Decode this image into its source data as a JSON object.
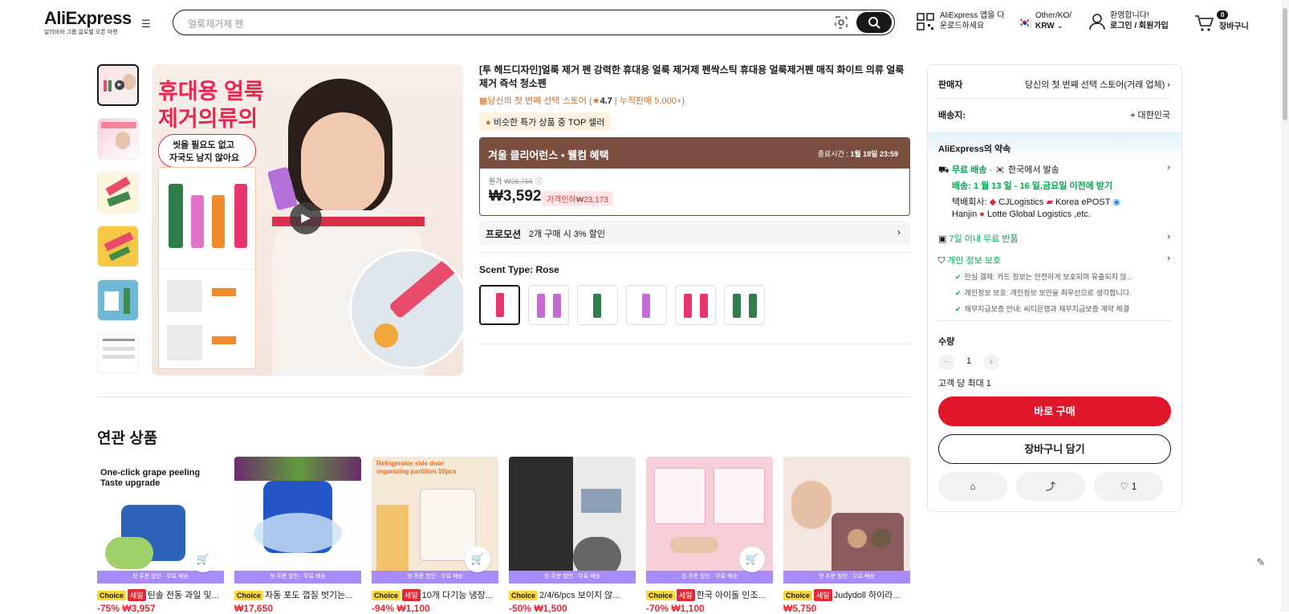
{
  "header": {
    "logo": "AliExpress",
    "logo_sub": "알리바바 그룹 글로벌 오픈 마켓",
    "search_placeholder": "얼룩제거제 펜",
    "app_line1": "AliExpress 앱을 다",
    "app_line2": "운로드하세요",
    "region_line1": "Other/KO/",
    "region_line2": "KRW",
    "account_line1": "환영합니다!",
    "account_line2": "로그인 / 회원가입",
    "cart_count": "0",
    "cart_label": "장바구니"
  },
  "product": {
    "title": "[투 헤드디자인]얼룩 제거 펜 강력한 휴대용 얼룩 제거제 펜싹스틱 휴대용 얼룩제거펜 매직 화이트 의류 얼룩제거 즉석 청소펜",
    "store_name": "당신의 첫 번째 선택 스토어",
    "rating": "4.7",
    "sold": "누적판매 5,000+",
    "top_badge": "비슷한 특가 상품 중 TOP 셀러",
    "image_text_1": "휴대용 얼룩",
    "image_text_2": "제거의류의",
    "image_text_3": "씻을 필요도 없고",
    "image_text_4": "자국도 남지 않아요"
  },
  "promo": {
    "name": "겨울 클리어런스 • 웰컴 혜택",
    "end_label": "종료시간 :",
    "end_value": "1월 18일 23:59",
    "orig_label": "원가",
    "orig_price": "₩26,765",
    "price": "₩3,592",
    "discount": "가격인하₩23,173"
  },
  "promotion_row": {
    "label": "프로모션",
    "text": "2개 구매 시 3% 할인"
  },
  "scent": {
    "label": "Scent Type: Rose"
  },
  "related": {
    "title": "연관 상품",
    "ship_text": "첫 주문 할인 · 무료 배송",
    "cards": [
      {
        "name": "틴솔 전동 과일 및...",
        "price": "-75% ₩3,957",
        "img_text": "One-click grape peeling Taste upgrade",
        "sale": true
      },
      {
        "name": "자동 포도 껍질 벗기는...",
        "price": "₩17,650",
        "img_text": "",
        "sale": false
      },
      {
        "name": "10개 다기능 냉장...",
        "price": "-94% ₩1,100",
        "img_text": "Refrigerator side door organizing partition 10pcs",
        "sale": true
      },
      {
        "name": "2/4/6/pcs 보이지 않...",
        "price": "-50% ₩1,500",
        "img_text": "",
        "sale": false
      },
      {
        "name": "한국 아이돌 인조...",
        "price": "-70% ₩1,100",
        "img_text": "",
        "sale": true
      },
      {
        "name": "Judydoll 하이라...",
        "price": "₩5,750",
        "img_text": "",
        "sale": true
      }
    ],
    "choice": "Choice",
    "sale": "세일"
  },
  "sidebar": {
    "seller_label": "판매자",
    "seller_value": "당신의 첫 번째 선택 스토어(거래 업체)",
    "ship_to_label": "배송지:",
    "ship_to_value": "대한민국",
    "promise": "AliExpress의 약속",
    "free_ship": "무료 배송",
    "ship_from": "한국에서 발송",
    "delivery": "배송: 1 월 13 일 - 16 일,금요일 이전에 받기",
    "carriers_label": "택배회사:",
    "carrier1": "CJLogistics",
    "carrier2": "Korea ePOST",
    "carrier3": "Hanjin",
    "carrier4": "Lotte Global Logistics ,etc.",
    "returns": "7일 이내 무료 반품",
    "privacy": "개인 정보 보호",
    "privacy_1": "안심 결제: 카드 정보는 안전하게 보호되며 유출되지 않...",
    "privacy_2": "개인정보 보호: 개인정보 보안을 최우선으로 생각합니다.",
    "privacy_3": "채무지급보증 안내: 씨티은행과 채무지급보증 계약 체결",
    "qty_label": "수량",
    "qty_value": "1",
    "max_label": "고객 당 최대 1",
    "buy_now": "바로 구매",
    "add_cart": "장바구니 담기",
    "wish_count": "1"
  },
  "colors": {
    "accent_red": "#e0162b",
    "promo_brown": "#7a4f40",
    "green": "#00a651",
    "choice_yellow": "#fdd835"
  }
}
